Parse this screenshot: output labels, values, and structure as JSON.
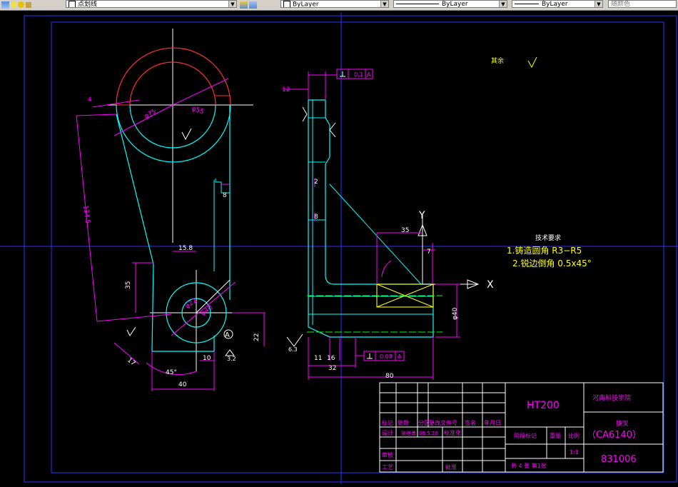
{
  "toolbar": {
    "layer_dropdown": "点划线",
    "color_dropdown": "ByLayer",
    "linetype_dropdown": "ByLayer",
    "lineweight_dropdown": "ByLayer",
    "plotstyle_dropdown": "随颜色"
  },
  "drawing": {
    "tolerance_top": "0.1",
    "tolerance_top_datum": "A",
    "tolerance_bottom": "0.08",
    "tolerance_bottom_datum": "A",
    "roughness_rest": "其余",
    "tech_title": "技术要求",
    "tech_req_1": "1.铸造圆角 R3−R5",
    "tech_req_2": "2.锐边倒角 0.5x45°",
    "axis_x": "X",
    "axis_y": "Y",
    "datum_a": "A",
    "dims": {
      "d_4": "4",
      "d_phi75": "φ75",
      "d_phi55": "φ55",
      "d_r8": "8",
      "d_1345": "134.5",
      "d_158": "15.8",
      "d_35v": "35",
      "d_phi22": "φ22",
      "d_phi40c": "φ40",
      "d_17": "17",
      "d_10": "10",
      "d_45deg": "45°",
      "d_40": "40",
      "d_22": "22",
      "d_12tol": "12",
      "d_35h": "35",
      "d_7": "7",
      "d_phi40": "φ40",
      "d_11": "11",
      "d_16": "16",
      "d_32": "32",
      "d_80": "80",
      "d_2": "2",
      "d_8": "8",
      "d_63": "6.3",
      "d_32r": "3.2"
    }
  },
  "title_block": {
    "material": "HT200",
    "school": "河南科技学院",
    "part_name": "拨叉",
    "model": "（CA6140）",
    "drawing_no": "831006",
    "col_mark": "标记",
    "col_count": "处数",
    "col_zone": "分区",
    "col_doc": "更改文件号",
    "col_sign": "签名",
    "col_date": "年月日",
    "row_design": "设计",
    "designer": "张继勇",
    "design_date": "09.5.20",
    "row_std": "标准化",
    "stage_mark": "阶段标记",
    "weight": "重量",
    "scale": "比例",
    "scale_value": "1:1",
    "row_check": "审核",
    "row_craft": "工艺",
    "row_approve": "批准",
    "sheets": "共 4 张  第1张"
  }
}
